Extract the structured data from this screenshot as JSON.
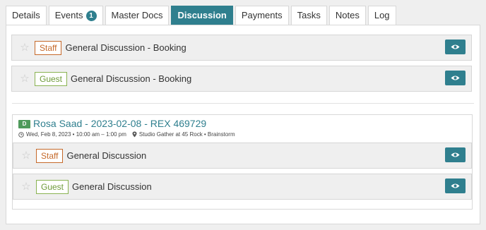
{
  "tabs": [
    {
      "label": "Details"
    },
    {
      "label": "Events",
      "badge": "1"
    },
    {
      "label": "Master Docs"
    },
    {
      "label": "Discussion",
      "active": true
    },
    {
      "label": "Payments"
    },
    {
      "label": "Tasks"
    },
    {
      "label": "Notes"
    },
    {
      "label": "Log"
    }
  ],
  "booking_threads": [
    {
      "tag": "Staff",
      "title": "General Discussion - Booking"
    },
    {
      "tag": "Guest",
      "title": "General Discussion - Booking"
    }
  ],
  "event": {
    "badge": "D",
    "title": "Rosa Saad - 2023-02-08 - REX 469729",
    "datetime": "Wed, Feb 8, 2023 • 10:00 am – 1:00 pm",
    "location": "Studio Gather at 45 Rock • Brainstorm",
    "threads": [
      {
        "tag": "Staff",
        "title": "General Discussion"
      },
      {
        "tag": "Guest",
        "title": "General Discussion"
      }
    ]
  },
  "colors": {
    "accent": "#2f7f8e",
    "staff": "#c5692a",
    "guest": "#6e9a3a",
    "event_badge": "#4f9a5b"
  },
  "icons": {
    "star": "star-outline-icon",
    "view": "eye-icon",
    "clock": "clock-icon",
    "location": "map-pin-icon"
  }
}
